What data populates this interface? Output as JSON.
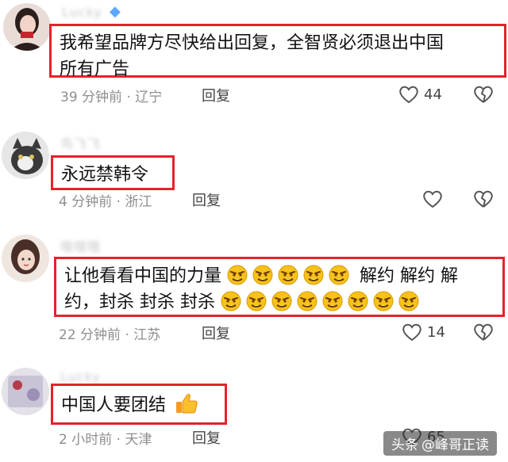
{
  "comments": [
    {
      "username": "Lucky",
      "text_lines": [
        "我希望品牌方尽快给出回复，全智贤必须退出中国",
        "所有广告"
      ],
      "time": "39 分钟前",
      "location": "辽宁",
      "reply_label": "回复",
      "likes": "44",
      "has_verify_badge": true
    },
    {
      "username": "鸟飞飞",
      "text_lines": [
        "永远禁韩令"
      ],
      "time": "4 分钟前",
      "location": "浙江",
      "reply_label": "回复",
      "likes": ""
    },
    {
      "username": "哦哦哦",
      "text_line1": "让他看看中国的力量",
      "text_line1_suffix": "解约 解约 解",
      "text_line2": "约，封杀 封杀 封杀",
      "time": "22 分钟前",
      "location": "江苏",
      "reply_label": "回复",
      "likes": "14",
      "emoji_name": "angry-face-emoji"
    },
    {
      "username": "Lucky",
      "text_lines": [
        "中国人要团结"
      ],
      "time": "2 小时前",
      "location": "天津",
      "reply_label": "回复",
      "likes": "65",
      "emoji_name": "thumbs-up-emoji"
    }
  ],
  "watermark": {
    "source": "头条",
    "author": "@峰哥正读"
  },
  "colors": {
    "highlight_border": "#e5222b",
    "meta_text": "#8e8e8e",
    "emoji_yellow": "#f7c21a"
  }
}
